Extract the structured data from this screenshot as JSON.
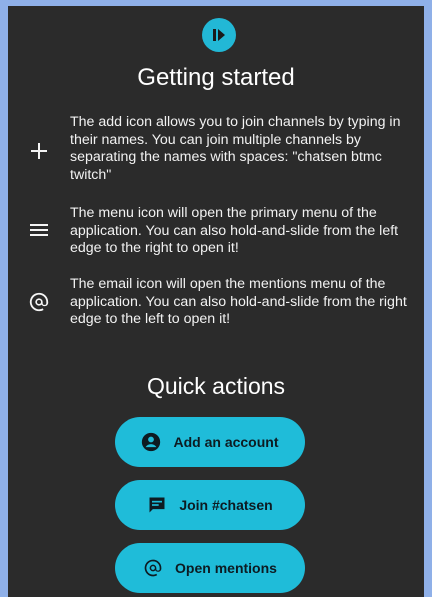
{
  "title": "Getting started",
  "tips": [
    {
      "icon": "plus-icon",
      "text": "The add icon allows you to join channels by typing in their names. You can join multiple channels by separating the names with spaces: \"chatsen btmc twitch\""
    },
    {
      "icon": "menu-icon",
      "text": "The menu icon will open the primary menu of the application. You can also hold-and-slide from the left edge to the right to open it!"
    },
    {
      "icon": "at-icon",
      "text": "The email icon will open the mentions menu of the application. You can also hold-and-slide from the right edge to the left to open it!"
    }
  ],
  "quick_actions": {
    "title": "Quick actions",
    "buttons": [
      {
        "label": "Add an account",
        "icon": "account-icon"
      },
      {
        "label": "Join #chatsen",
        "icon": "chat-icon"
      },
      {
        "label": "Open mentions",
        "icon": "at-icon"
      }
    ]
  },
  "colors": {
    "background": "#2b2b2b",
    "accent": "#1fbcd9",
    "frame": "#8fb0e8"
  }
}
